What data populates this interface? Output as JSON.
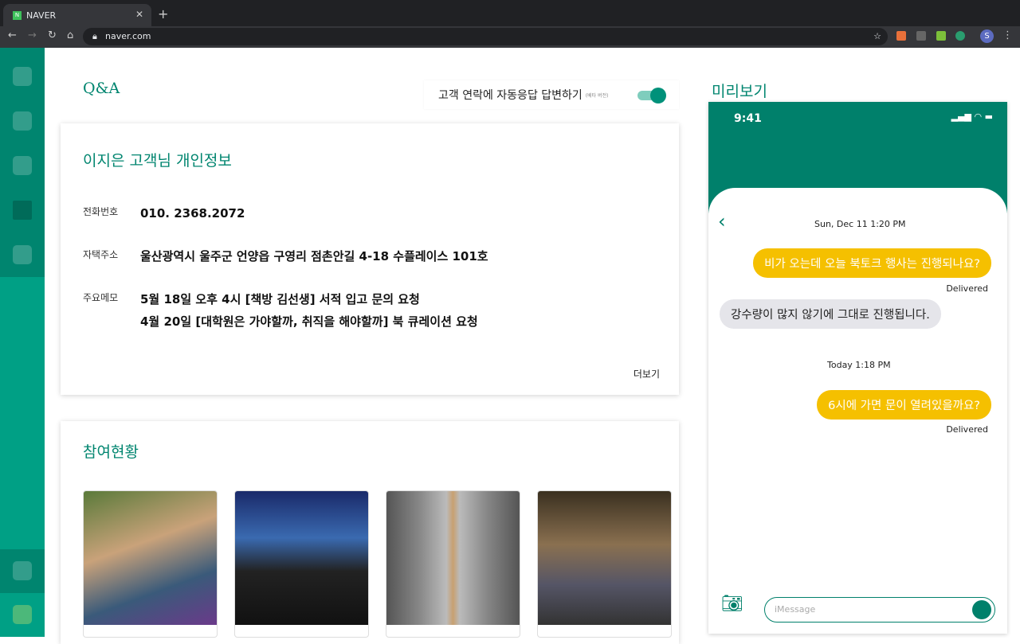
{
  "browser": {
    "tab_title": "NAVER",
    "favicon": "N",
    "url": "naver.com",
    "profile": "S"
  },
  "qa": {
    "title": "Q&A",
    "auto_reply_label": "고객 연락에 자동응답 답변하기",
    "beta": "(베타 버전)",
    "auto_reply_on": true
  },
  "customer": {
    "title": "이지은 고객님 개인정보",
    "phone_label": "전화번호",
    "phone": "010. 2368.2072",
    "address_label": "자택주소",
    "address": "울산광역시 울주군 언양읍 구영리 점촌안길 4-18 수플레이스 101호",
    "memo_label": "주요메모",
    "memo": [
      "5월 18일 오후 4시 [책방 김선생] 서적 입고 문의 요청",
      "4월 20일 [대학원은 가야할까, 취직을 해야할까] 북 큐레이션 요청"
    ],
    "more": "더보기"
  },
  "participation": {
    "title": "참여현황"
  },
  "preview": {
    "title": "미리보기",
    "time": "9:41",
    "messages": [
      {
        "stamp": "Sun, Dec 11 1:20 PM"
      },
      {
        "out": "비가 오는데 오늘 북토크 행사는 진행되나요?",
        "status": "Delivered"
      },
      {
        "in": "강수량이 많지 않기에 그대로 진행됩니다."
      },
      {
        "stamp": "Today 1:18 PM"
      },
      {
        "out": "6시에 가면 문이 열려있을까요?",
        "status": "Delivered"
      }
    ],
    "input_placeholder": "iMessage"
  },
  "colors": {
    "accent": "#00856f",
    "bubble_out": "#f5c000"
  }
}
